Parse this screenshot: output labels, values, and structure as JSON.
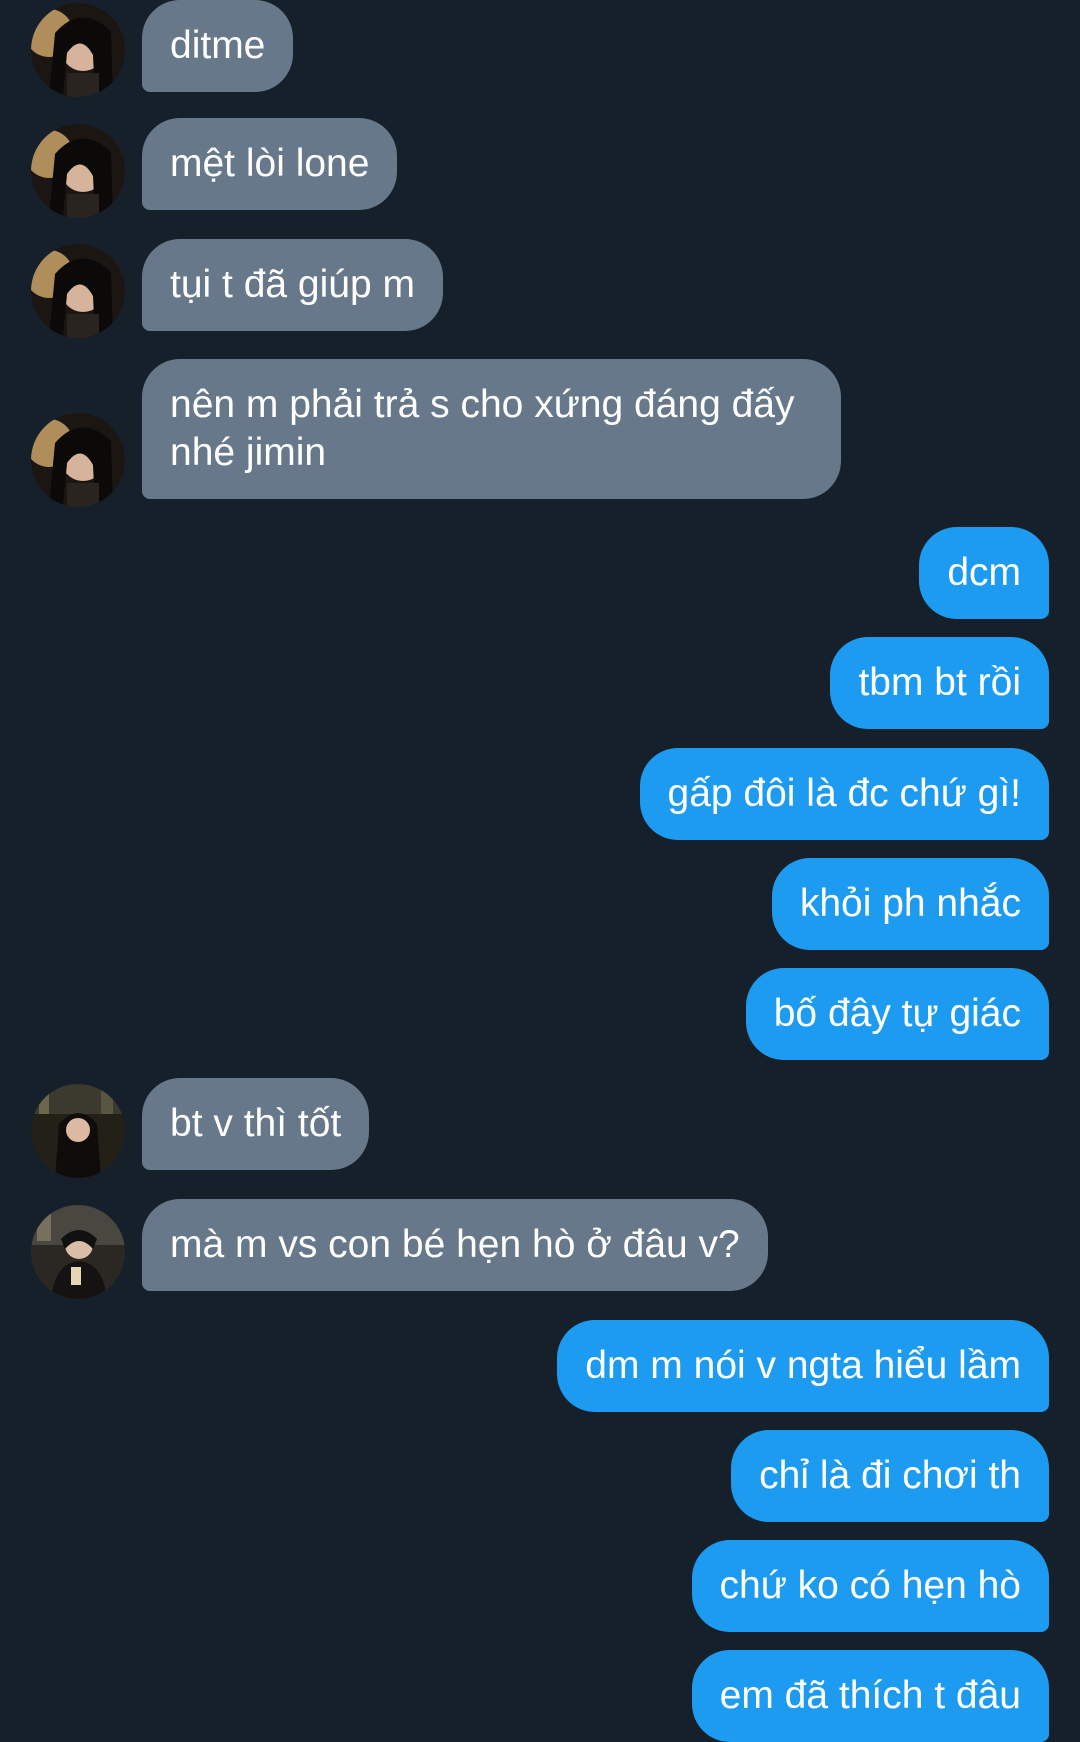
{
  "conversation": {
    "messages": [
      {
        "from": "other",
        "avatar": "girl-avatar",
        "text": "ditme"
      },
      {
        "from": "other",
        "avatar": "girl-avatar",
        "text": "mệt lòi lone"
      },
      {
        "from": "other",
        "avatar": "girl-avatar",
        "text": "tụi t đã giúp m"
      },
      {
        "from": "other",
        "avatar": "girl-avatar",
        "text": "nên m phải trả s cho xứng đáng đấy nhé jimin"
      },
      {
        "from": "me",
        "text": "dcm"
      },
      {
        "from": "me",
        "text": "tbm bt rồi"
      },
      {
        "from": "me",
        "text": "gấp đôi là đc chứ gì!"
      },
      {
        "from": "me",
        "text": "khỏi ph nhắc"
      },
      {
        "from": "me",
        "text": "bố đây tự giác"
      },
      {
        "from": "other",
        "avatar": "second-avatar",
        "text": "bt v thì tốt"
      },
      {
        "from": "other",
        "avatar": "third-avatar",
        "text": "mà m vs con bé hẹn hò ở đâu v?"
      },
      {
        "from": "me",
        "text": "dm m nói v ngta hiểu lầm"
      },
      {
        "from": "me",
        "text": "chỉ là đi chơi th"
      },
      {
        "from": "me",
        "text": "chứ ko có hẹn hò"
      },
      {
        "from": "me",
        "text": "em đã thích t đâu"
      }
    ]
  },
  "colors": {
    "background": "#15202b",
    "incoming_bubble": "#66788a",
    "outgoing_bubble": "#1d9bf0",
    "text": "#ffffff"
  }
}
